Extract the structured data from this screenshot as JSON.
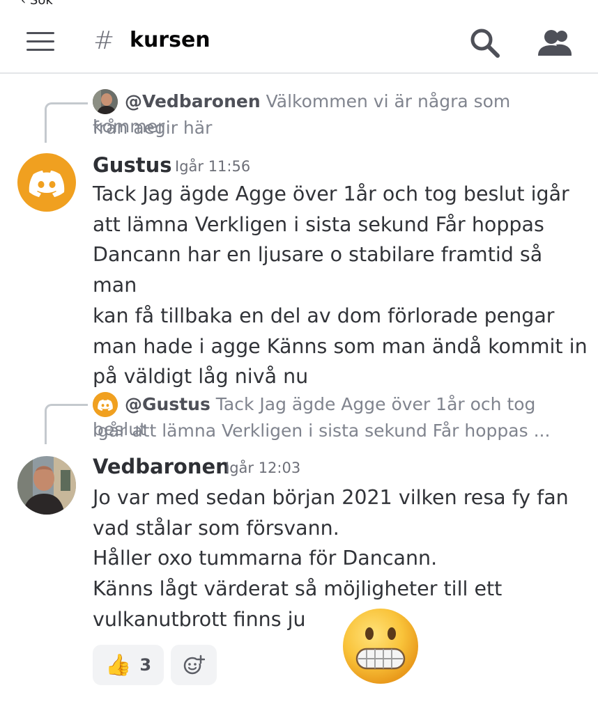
{
  "status_bar": {
    "back_fragment": "‹ Sök"
  },
  "header": {
    "channel_prefix": "#",
    "channel_name": "kursen"
  },
  "messages": [
    {
      "reply_to": {
        "author": "@Vedbaronen",
        "snippet_line1": "Välkommen vi är några som kommer",
        "snippet_line2": "från aegir här"
      },
      "author": "Gustus",
      "timestamp": "Igår 11:56",
      "avatar": "discord-logo",
      "avatar_color": "#f0a020",
      "text": "Tack Jag ägde Agge över 1år och tog beslut igår\natt lämna Verkligen i sista sekund  Får hoppas\nDancann har en ljusare o stabilare framtid så man\nkan få tillbaka en del av dom förlorade pengar\nman hade i agge Känns som man ändå kommit in\npå väldigt låg nivå nu"
    },
    {
      "reply_to": {
        "author": "@Gustus",
        "snippet_line1": "Tack Jag ägde Agge över 1år och tog beslut",
        "snippet_line2": "igår att lämna Verkligen i sista sekund  Får hoppas ..."
      },
      "author": "Vedbaronen",
      "timestamp": "Igår 12:03",
      "avatar": "user-photo",
      "text": "Jo var med sedan början 2021 vilken resa fy fan\nvad stålar som försvann.\nHåller oxo tummarna för Dancann.\nKänns lågt värderat så möjligheter till ett\nvulkanutbrott finns ju",
      "reactions": [
        {
          "emoji": "👍",
          "count": "3"
        }
      ],
      "add_reaction_icon": "add-reaction-icon",
      "sticker": "grimacing-face"
    }
  ]
}
